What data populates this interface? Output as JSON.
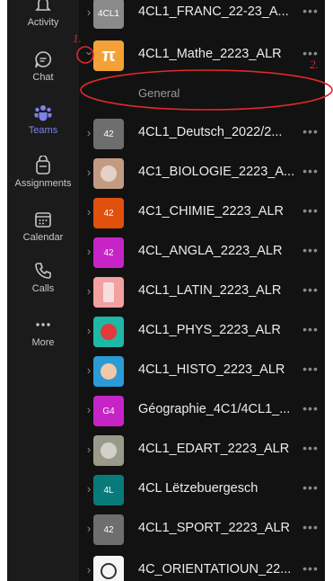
{
  "nav": [
    {
      "id": "activity",
      "label": "Activity",
      "icon": "bell-icon",
      "active": false
    },
    {
      "id": "chat",
      "label": "Chat",
      "icon": "chat-icon",
      "active": false
    },
    {
      "id": "teams",
      "label": "Teams",
      "icon": "teams-icon",
      "active": true
    },
    {
      "id": "assignments",
      "label": "Assignments",
      "icon": "assignments-icon",
      "active": false
    },
    {
      "id": "calendar",
      "label": "Calendar",
      "icon": "calendar-icon",
      "active": false
    },
    {
      "id": "calls",
      "label": "Calls",
      "icon": "phone-icon",
      "active": false
    },
    {
      "id": "more",
      "label": "More",
      "icon": "more-dots-icon",
      "active": false
    }
  ],
  "colors": {
    "accent": "#7b83eb",
    "annotation": "#e0282e"
  },
  "teams": [
    {
      "name": "4CL1_FRANC_22-23_A...",
      "avatar_text": "4CL1",
      "avatar_color": "#8a8a8a",
      "avatar_icon": "photo-avatar-icon"
    },
    {
      "name": "4CL1_Mathe_2223_ALR",
      "avatar_text": "π",
      "avatar_color": "#f4a236",
      "avatar_icon": "pi-icon",
      "expanded": true
    },
    {
      "name": "4CL1_Deutsch_2022/2...",
      "avatar_text": "42",
      "avatar_color": "#6e6e6e",
      "avatar_icon": "text-avatar-icon"
    },
    {
      "name": "4C1_BIOLOGIE_2223_A...",
      "avatar_text": "",
      "avatar_color": "#c49a83",
      "avatar_icon": "crowd-photo-icon"
    },
    {
      "name": "4C1_CHIMIE_2223_ALR",
      "avatar_text": "42",
      "avatar_color": "#e0510e",
      "avatar_icon": "text-avatar-icon"
    },
    {
      "name": "4CL_ANGLA_2223_ALR",
      "avatar_text": "42",
      "avatar_color": "#c724c7",
      "avatar_icon": "text-avatar-icon"
    },
    {
      "name": "4CL1_LATIN_2223_ALR",
      "avatar_text": "",
      "avatar_color": "#f2a0a0",
      "avatar_icon": "column-icon"
    },
    {
      "name": "4CL1_PHYS_2223_ALR",
      "avatar_text": "",
      "avatar_color": "#1fb8a6",
      "avatar_icon": "ping-pong-icon"
    },
    {
      "name": "4CL1_HISTO_2223_ALR",
      "avatar_text": "",
      "avatar_color": "#2a9bd6",
      "avatar_icon": "bust-icon"
    },
    {
      "name": "Géographie_4C1/4CL1_...",
      "avatar_text": "G4",
      "avatar_color": "#c724c7",
      "avatar_icon": "text-avatar-icon"
    },
    {
      "name": "4CL1_EDART_2223_ALR",
      "avatar_text": "",
      "avatar_color": "#9a9a8a",
      "avatar_icon": "photo-avatar-icon"
    },
    {
      "name": "4CL Lëtzebuergesch",
      "avatar_text": "4L",
      "avatar_color": "#087a7a",
      "avatar_icon": "text-avatar-icon"
    },
    {
      "name": "4CL1_SPORT_2223_ALR",
      "avatar_text": "42",
      "avatar_color": "#6e6e6e",
      "avatar_icon": "text-avatar-icon"
    },
    {
      "name": "4C_ORIENTATIOUN_22...",
      "avatar_text": "",
      "avatar_color": "#f5f5f5",
      "avatar_icon": "sketch-figure-icon"
    }
  ],
  "channel": {
    "name": "General"
  },
  "more_glyph": "•••",
  "annotations": {
    "mark1": "1.",
    "mark2": "2."
  }
}
